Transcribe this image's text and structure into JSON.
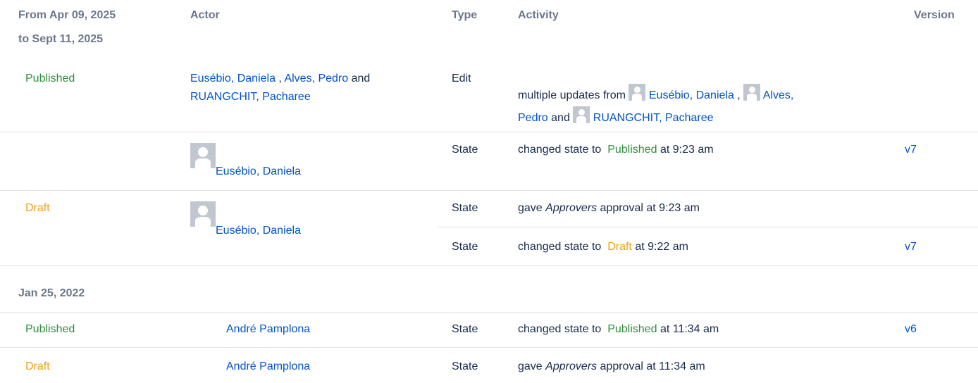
{
  "header": {
    "date_range_line1": "From Apr 09, 2025",
    "date_range_line2": "to Sept 11, 2025",
    "actor": "Actor",
    "type": "Type",
    "activity": "Activity",
    "version": "Version"
  },
  "group2_date": "Jan 25, 2022",
  "users": {
    "daniela": "Eusébio, Daniela",
    "pedro": "Alves, Pedro",
    "pedro_part1": "Alves,",
    "pedro_part2": "Pedro",
    "pacharee": "RUANGCHIT, Pacharee",
    "andre": "André Pamplona"
  },
  "text": {
    "comma": ",",
    "and": "and",
    "multiple_updates_from": "multiple updates from",
    "changed_state_to": "changed state to",
    "gave": "gave",
    "approvers": "Approvers",
    "approval_at_923": "approval at 9:23 am",
    "approval_at_1134": "approval at 11:34 am",
    "at_923": "at 9:23 am",
    "at_922": "at 9:22 am",
    "at_1134": "at 11:34 am"
  },
  "states": {
    "published": "Published",
    "draft": "Draft"
  },
  "types": {
    "edit": "Edit",
    "state": "State"
  },
  "versions": {
    "v7": "v7",
    "v6": "v6"
  },
  "colors": {
    "link": "#0052cc",
    "published": "#2e8f3b",
    "draft": "#f0a01a",
    "header": "#6b778c",
    "divider": "#dfe1e6",
    "avatar": "#c1c7d0"
  }
}
